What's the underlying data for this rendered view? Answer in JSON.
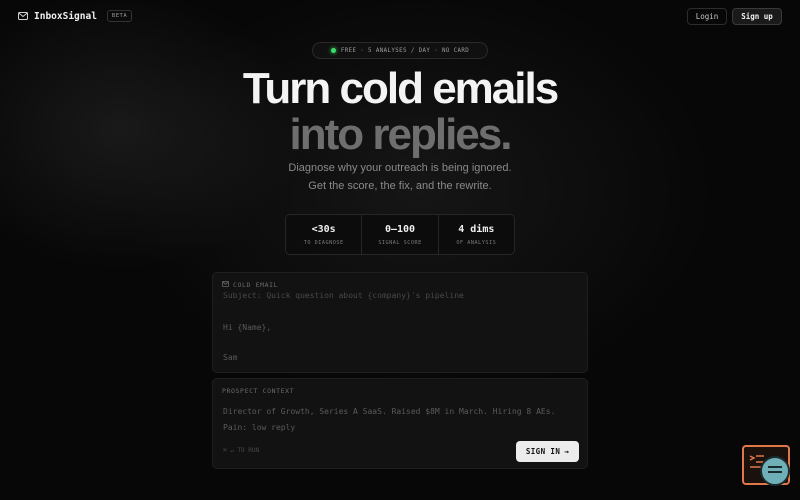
{
  "nav": {
    "brand": "InboxSignal",
    "badge": "BETA",
    "login": "Login",
    "signup": "Sign up"
  },
  "pill": {
    "text": "FREE · 5 ANALYSES / DAY · NO CARD"
  },
  "hero": {
    "line1": "Turn cold emails",
    "line2": "into replies.",
    "sub1": "Diagnose why your outreach is being ignored.",
    "sub2": "Get the score, the fix, and the rewrite."
  },
  "stats": [
    {
      "value": "<30s",
      "label": "TO DIAGNOSE"
    },
    {
      "value": "0–100",
      "label": "SIGNAL SCORE"
    },
    {
      "value": "4 dims",
      "label": "OF ANALYSIS"
    }
  ],
  "email_panel": {
    "label": "COLD EMAIL",
    "clipped_line": "Subject: Quick question about {company}'s pipeline",
    "greeting": "Hi {Name},",
    "signoff": "Sam"
  },
  "context_panel": {
    "label": "PROSPECT CONTEXT",
    "line1": "Director of Growth, Series A SaaS. Raised $8M in March. Hiring 8 AEs.",
    "line2": "Pain: low reply",
    "hint": "⌘ ↵ TO RUN",
    "signin": "SIGN IN",
    "signin_arrow": "→"
  },
  "colors": {
    "accent_dot": "#3ddc6a",
    "widget_border": "#e0784a"
  }
}
